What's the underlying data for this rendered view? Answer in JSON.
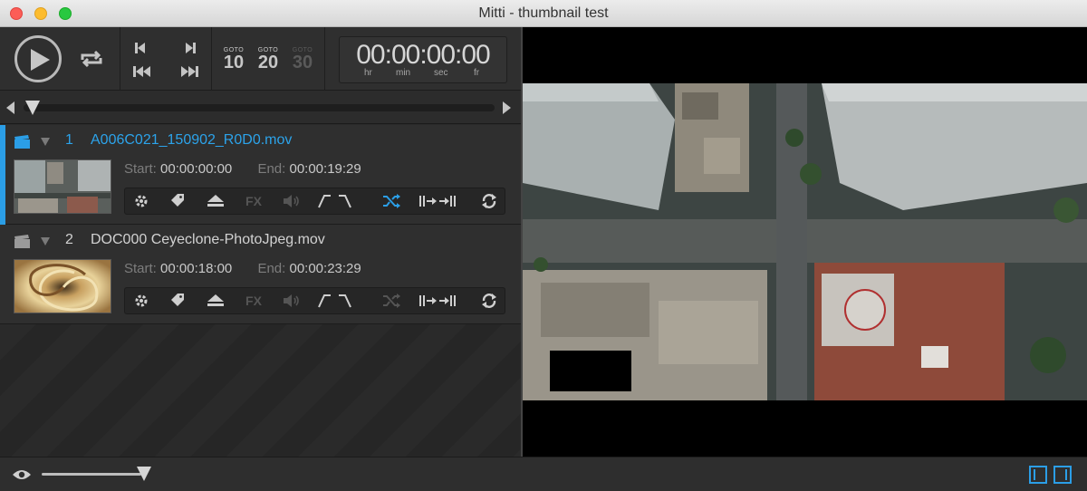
{
  "window": {
    "title": "Mitti - thumbnail test"
  },
  "transport": {
    "goto": [
      {
        "label": "GOTO",
        "value": "10",
        "enabled": true
      },
      {
        "label": "GOTO",
        "value": "20",
        "enabled": true
      },
      {
        "label": "GOTO",
        "value": "30",
        "enabled": false
      }
    ],
    "timecode": {
      "value": "00:00:00:00",
      "units": [
        "hr",
        "min",
        "sec",
        "fr"
      ]
    }
  },
  "cues": [
    {
      "number": "1",
      "name": "A006C021_150902_R0D0.mov",
      "start_label": "Start:",
      "start": "00:00:00:00",
      "end_label": "End:",
      "end": "00:00:19:29",
      "active": true
    },
    {
      "number": "2",
      "name": "DOC000 Ceyeclone-PhotoJpeg.mov",
      "start_label": "Start:",
      "start": "00:00:18:00",
      "end_label": "End:",
      "end": "00:00:23:29",
      "active": false
    }
  ],
  "colors": {
    "accent": "#2b9ee6",
    "background": "#2d2d2d"
  },
  "icons": [
    "play-icon",
    "loop-icon",
    "previous-icon",
    "next-icon",
    "rewind-icon",
    "fast-forward-icon",
    "clapper-icon",
    "gear-icon",
    "tag-icon",
    "eject-icon",
    "fx-icon",
    "volume-icon",
    "fade-icon",
    "shuffle-icon",
    "jump-icon",
    "reload-icon",
    "eye-icon"
  ]
}
